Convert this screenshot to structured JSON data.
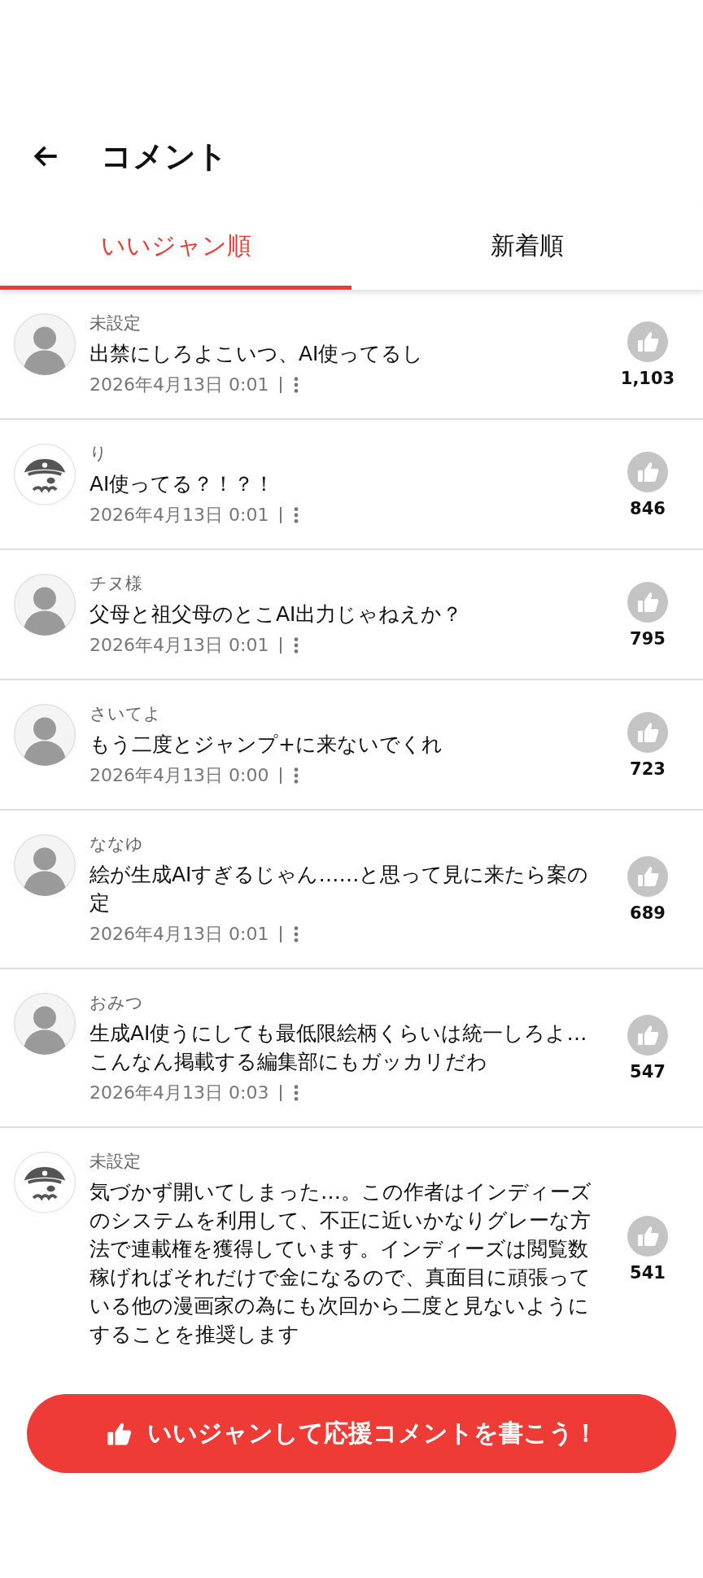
{
  "header": {
    "title": "コメント"
  },
  "tabs": [
    {
      "label": "いいジャン順",
      "selected": true
    },
    {
      "label": "新着順",
      "selected": false
    }
  ],
  "comments": [
    {
      "name": "未設定",
      "text": "出禁にしろよこいつ、AI使ってるし",
      "date": "2026年4月13日 0:01",
      "likes": "1,103"
    },
    {
      "avatar": {
        "kind": "default"
      },
      "name": "り",
      "text": "AI使ってる？！？！",
      "date": "2026年4月13日 0:01",
      "likes": "846"
    },
    {
      "name": "チヌ様",
      "text": "父母と祖父母のとこAI出力じゃねえか？",
      "date": "2026年4月13日 0:01",
      "likes": "795"
    },
    {
      "name": "さいてよ",
      "text": "もう二度とジャンプ+に来ないでくれ",
      "date": "2026年4月13日 0:00",
      "likes": "723"
    },
    {
      "name": "ななゆ",
      "text": "絵が生成AIすぎるじゃん……と思って見に来たら案の定",
      "date": "2026年4月13日 0:01",
      "likes": "689"
    },
    {
      "name": "おみつ",
      "text": "生成AI使うにしても最低限絵柄くらいは統一しろよ…こんなん掲載する編集部にもガッカリだわ",
      "date": "2026年4月13日 0:03",
      "likes": "547"
    },
    {
      "avatar": {
        "kind": "default"
      },
      "name": "未設定",
      "text": "気づかず開いてしまった…。この作者はインディーズのシステムを利用して、不正に近いかなりグレーな方法で連載権を獲得しています。インディーズは閲覧数稼げればそれだけで金になるので、真面目に頑張っている他の漫画家の為にも次回から二度と見ないようにすることを推奨します",
      "likes": "541"
    }
  ],
  "footer_button": {
    "label": "いいジャンして応援コメントを書こう！"
  }
}
